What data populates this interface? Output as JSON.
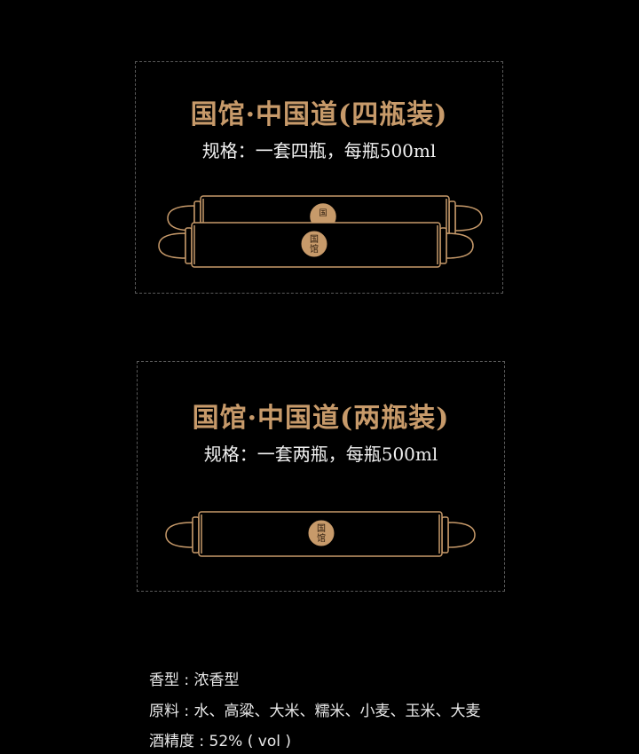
{
  "colors": {
    "background": "#000000",
    "gold": "#c79a6a",
    "text": "#f2f2f2"
  },
  "packages": [
    {
      "title": "国馆·中国道(四瓶装)",
      "spec": "规格：一套四瓶，每瓶500ml",
      "seal": "国馆",
      "icon": "double-scroll-icon"
    },
    {
      "title": "国馆·中国道(两瓶装)",
      "spec": "规格：一套两瓶，每瓶500ml",
      "seal": "国馆",
      "icon": "scroll-icon"
    }
  ],
  "info": {
    "aroma": "香型 : 浓香型",
    "ingredients": "原料 : 水、高粱、大米、糯米、小麦、玉米、大麦",
    "abv": "酒精度 : 52% ( vol )"
  }
}
